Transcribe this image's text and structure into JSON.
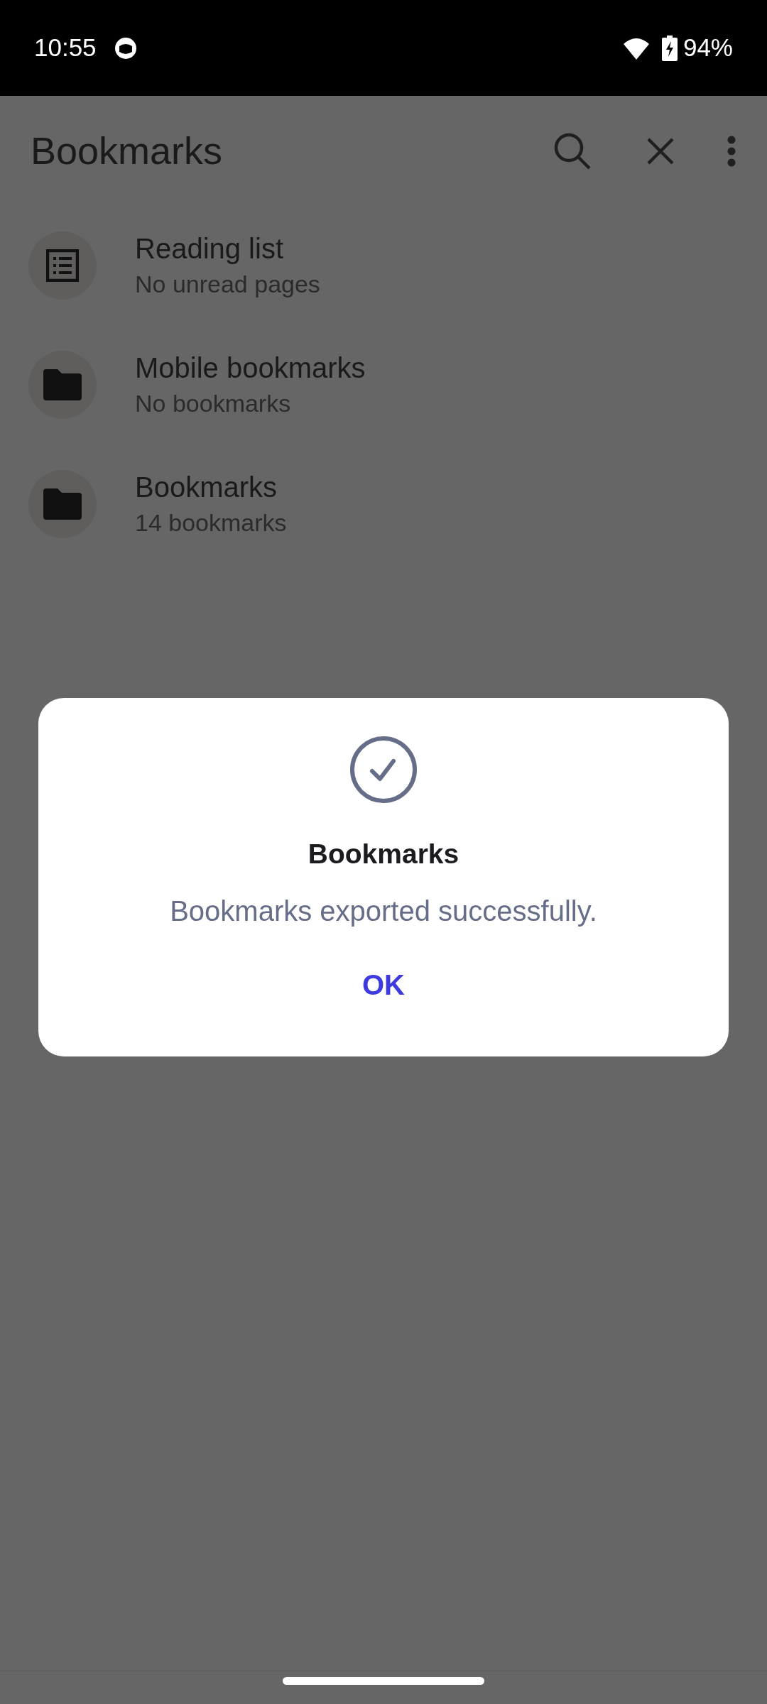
{
  "status_bar": {
    "time": "10:55",
    "battery": "94%"
  },
  "toolbar": {
    "title": "Bookmarks"
  },
  "items": [
    {
      "kind": "list",
      "title": "Reading list",
      "subtitle": "No unread pages"
    },
    {
      "kind": "folder",
      "title": "Mobile bookmarks",
      "subtitle": "No bookmarks"
    },
    {
      "kind": "folder",
      "title": "Bookmarks",
      "subtitle": "14 bookmarks"
    }
  ],
  "dialog": {
    "title": "Bookmarks",
    "message": "Bookmarks exported successfully.",
    "button": "OK"
  }
}
